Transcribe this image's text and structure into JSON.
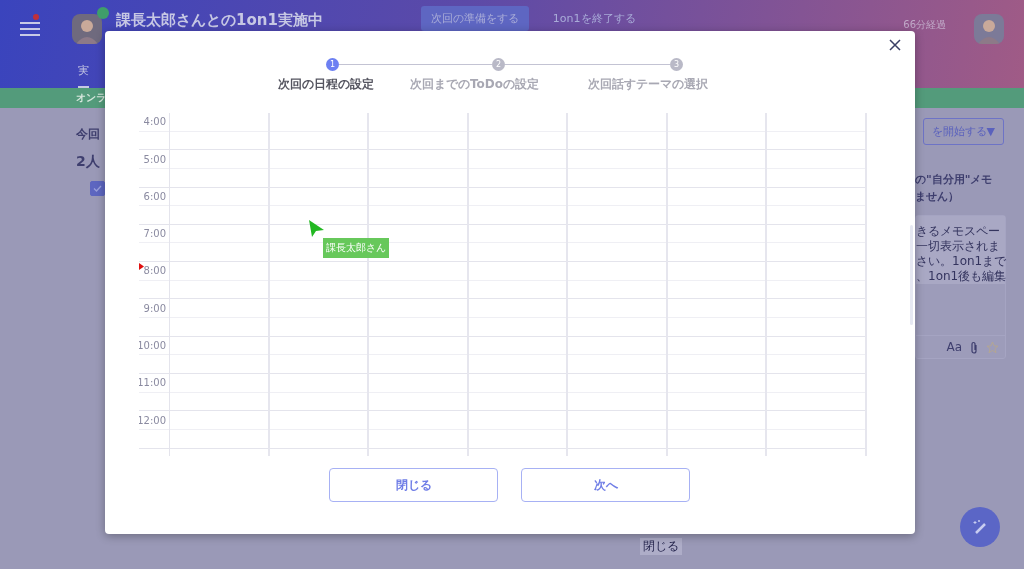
{
  "header": {
    "title": "課長太郎さんとの1on1実施中",
    "actions": [
      "次回の準備をする",
      "1on1を終了する"
    ],
    "elapsed": "66分経過",
    "menu_badge": true,
    "online": true
  },
  "tab": {
    "label": "実",
    "selected": true
  },
  "status_bar": {
    "label": "オンラ"
  },
  "left": {
    "heading": "今回",
    "subheading": "2人",
    "checked": true
  },
  "right": {
    "start_button": "を開始する▼",
    "memo_title": [
      "の\"自分用\"メモ",
      "ません）"
    ],
    "memo_lines": [
      "きるメモスペー",
      "一切表示されま",
      "さい。1on1まで",
      "、1on1後も編集"
    ],
    "format_tool": "Aa",
    "starred": false
  },
  "footer_button": "閉じる",
  "modal": {
    "steps": [
      {
        "number": "1",
        "label": "次回の日程の設定",
        "selected": true
      },
      {
        "number": "2",
        "label": "次回までのToDoの設定",
        "selected": false
      },
      {
        "number": "3",
        "label": "次回話すテーマの選択",
        "selected": false
      }
    ],
    "calendar": {
      "times": [
        "4:00",
        "5:00",
        "6:00",
        "7:00",
        "8:00",
        "9:00",
        "10:00",
        "11:00",
        "12:00"
      ],
      "cursor_label": "課長太郎さん"
    },
    "buttons": [
      "閉じる",
      "次へ"
    ]
  }
}
